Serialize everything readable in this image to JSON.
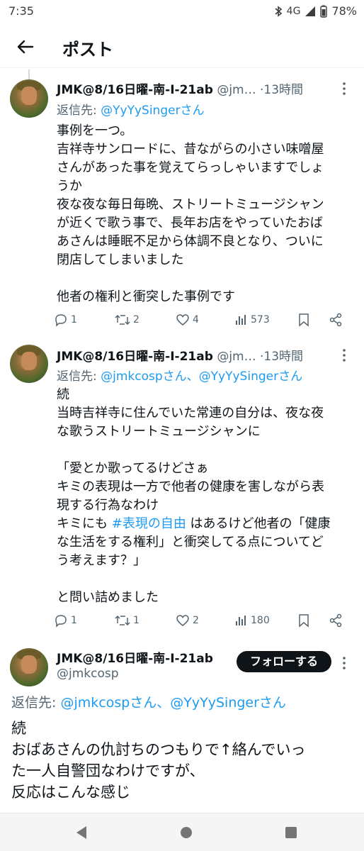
{
  "status_bar": {
    "time": "7:35",
    "network": "4G",
    "battery": "78%"
  },
  "header": {
    "title": "ポスト"
  },
  "tweets": [
    {
      "name": "JMK@8/16日曜-南-I-21ab",
      "handle": "@jm…",
      "dot": "·",
      "time": "13時間",
      "reply_prefix": "返信先: ",
      "reply_links": "@YyYySingerさん",
      "lines": [
        "事例を一つ。",
        "吉祥寺サンロードに、昔ながらの小さい味噌屋",
        "さんがあった事を覚えてらっしゃいますでしょ",
        "うか",
        "夜な夜な毎日毎晩、ストリートミュージシャン",
        "が近くで歌う事で、長年お店をやっていたおば",
        "あさんは睡眠不足から体調不良となり、ついに",
        "閉店してしまいました",
        "",
        "他者の権利と衝突した事例です"
      ],
      "stats": {
        "replies": "1",
        "reposts": "2",
        "likes": "4",
        "views": "573"
      }
    },
    {
      "name": "JMK@8/16日曜-南-I-21ab",
      "handle": "@jm…",
      "dot": "·",
      "time": "13時間",
      "reply_prefix": "返信先: ",
      "reply_links": "@jmkcospさん、@YyYySingerさん",
      "lines_before": [
        "続",
        "当時吉祥寺に住んでいた常連の自分は、夜な夜",
        "な歌うストリートミュージシャンに",
        "",
        "「愛とか歌ってるけどさぁ",
        "キミの表現は一方で他者の健康を害しながら表",
        "現する行為なわけ"
      ],
      "hashtag_line": {
        "pre": "キミにも ",
        "tag": "#表現の自由",
        "post": " はあるけど他者の「健康"
      },
      "lines_after": [
        "な生活をする権利」と衝突してる点についてど",
        "う考えます？」",
        "",
        "と問い詰めました"
      ],
      "stats": {
        "replies": "1",
        "reposts": "1",
        "likes": "2",
        "views": "180"
      }
    },
    {
      "name": "JMK@8/16日曜-南-I-21ab",
      "handle": "@jmkcosp",
      "follow_label": "フォローする",
      "reply_prefix": "返信先: ",
      "reply_links": "@jmkcospさん、@YyYySingerさん",
      "lines": [
        "続",
        "おばあさんの仇討ちのつもりで↑絡んでいっ",
        "た一人自警団なわけですが、",
        "反応はこんな感じ"
      ]
    }
  ],
  "icons": {
    "back": "arrow-left-icon",
    "more": "more-vertical-icon",
    "reply": "reply-icon",
    "repost": "repost-icon",
    "like": "heart-icon",
    "views": "views-bar-icon",
    "bookmark": "bookmark-icon",
    "share": "share-icon"
  },
  "colors": {
    "link": "#1d9bf0",
    "text": "#0f1419",
    "secondary": "#536471",
    "follow_bg": "#0f1419"
  }
}
